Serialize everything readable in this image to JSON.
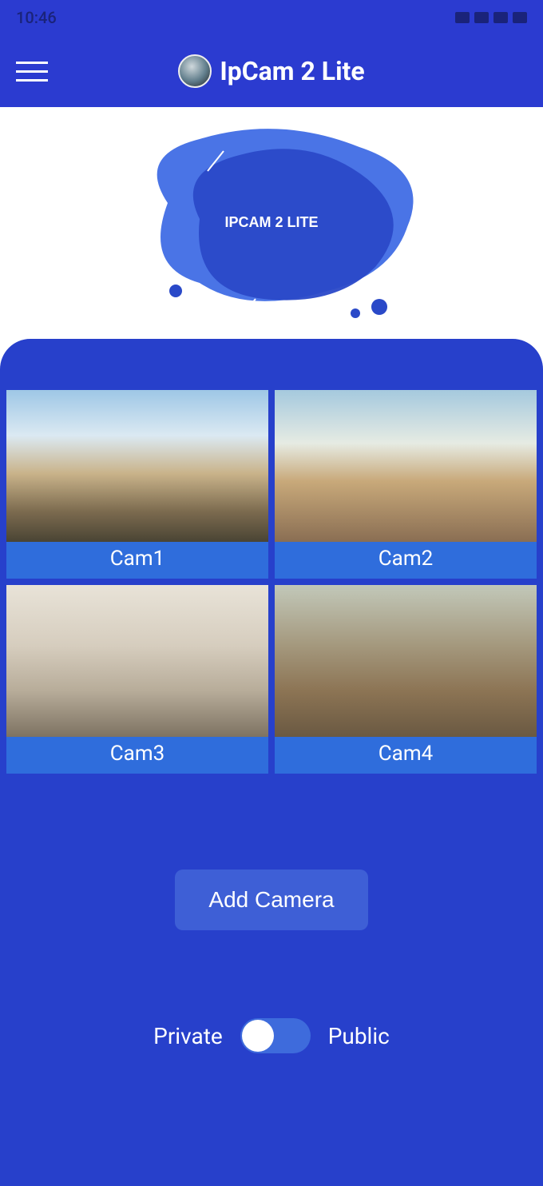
{
  "status": {
    "time": "10:46"
  },
  "header": {
    "title": "IpCam 2 Lite"
  },
  "hero": {
    "label": "IPCAM 2 LITE"
  },
  "cameras": [
    {
      "label": "Cam1"
    },
    {
      "label": "Cam2"
    },
    {
      "label": "Cam3"
    },
    {
      "label": "Cam4"
    }
  ],
  "actions": {
    "add_camera": "Add Camera"
  },
  "toggle": {
    "left_label": "Private",
    "right_label": "Public",
    "state": "private"
  }
}
